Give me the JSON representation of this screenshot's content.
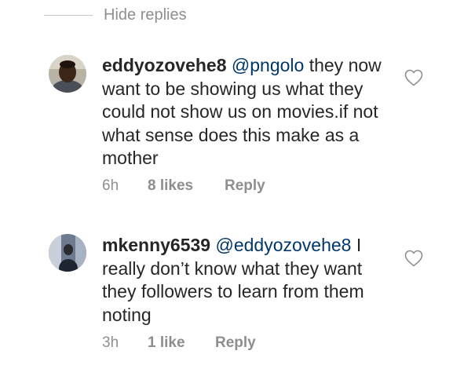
{
  "hide_replies_label": "Hide replies",
  "comments": [
    {
      "username": "eddyozovehe8",
      "mention": "@pngolo",
      "text": " they now want to be showing us what they could not show us on movies.if not what sense does this make as a mother",
      "time": "6h",
      "likes": "8 likes",
      "reply_label": "Reply",
      "avatar_icon": "user-avatar-photo",
      "like_icon": "heart-outline-icon"
    },
    {
      "username": "mkenny6539",
      "mention": "@eddyozovehe8",
      "text": "I really don’t know what they want they followers to learn from them noting",
      "time": "3h",
      "likes": "1 like",
      "reply_label": "Reply",
      "avatar_icon": "user-avatar-photo",
      "like_icon": "heart-outline-icon"
    }
  ],
  "colors": {
    "text": "#262626",
    "secondary": "#8e8e8e",
    "mention": "#00376b",
    "divider": "#c7c7c7"
  }
}
